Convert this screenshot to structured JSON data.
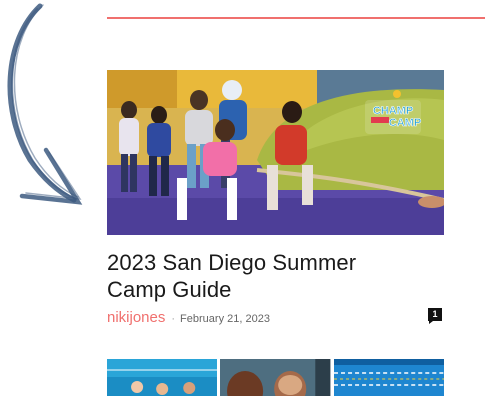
{
  "colors": {
    "accent": "#f0706e",
    "comment_badge": "#111111",
    "text": "#1a1a1a"
  },
  "decor": {
    "arrow_icon": "curved-arrow-pointing-down-right"
  },
  "post": {
    "title": "2023 San Diego Summer Camp Guide",
    "author": "nikijones",
    "separator": "·",
    "date": "February 21, 2023",
    "comment_count": "1",
    "image_sign": {
      "line1": "CHAMP",
      "line2": "CAMP"
    }
  },
  "next_posts": {
    "thumbnails": [
      "pool-icon",
      "kids-photo-icon",
      "pool-lanes-icon"
    ]
  }
}
